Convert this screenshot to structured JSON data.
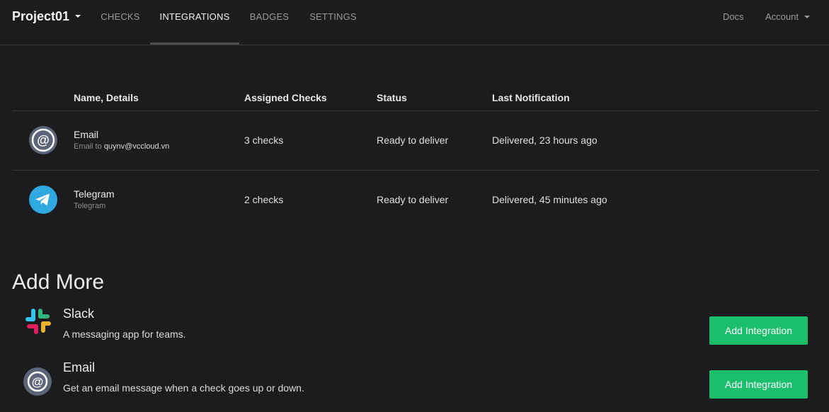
{
  "navbar": {
    "project": "Project01",
    "tabs": [
      {
        "label": "CHECKS"
      },
      {
        "label": "INTEGRATIONS"
      },
      {
        "label": "BADGES"
      },
      {
        "label": "SETTINGS"
      }
    ],
    "docs": "Docs",
    "account": "Account"
  },
  "table": {
    "headers": {
      "name": "Name, Details",
      "assigned": "Assigned Checks",
      "status": "Status",
      "last": "Last Notification"
    },
    "rows": [
      {
        "icon": "email-icon",
        "name": "Email",
        "sub_prefix": "Email to",
        "sub_value": "quynv@vccloud.vn",
        "assigned": "3 checks",
        "status": "Ready to deliver",
        "last": "Delivered, 23 hours ago"
      },
      {
        "icon": "telegram-icon",
        "name": "Telegram",
        "sub_prefix": "Telegram",
        "sub_value": "",
        "assigned": "2 checks",
        "status": "Ready to deliver",
        "last": "Delivered, 45 minutes ago"
      }
    ]
  },
  "add_more": {
    "title": "Add More",
    "items": [
      {
        "icon": "slack-icon",
        "title": "Slack",
        "desc": "A messaging app for teams.",
        "button": "Add Integration"
      },
      {
        "icon": "email-icon",
        "title": "Email",
        "desc": "Get an email message when a check goes up or down.",
        "button": "Add Integration"
      }
    ]
  },
  "colors": {
    "background": "#1c1b1e",
    "accent_green": "#1bbf6b",
    "telegram_blue": "#30a8e0"
  }
}
